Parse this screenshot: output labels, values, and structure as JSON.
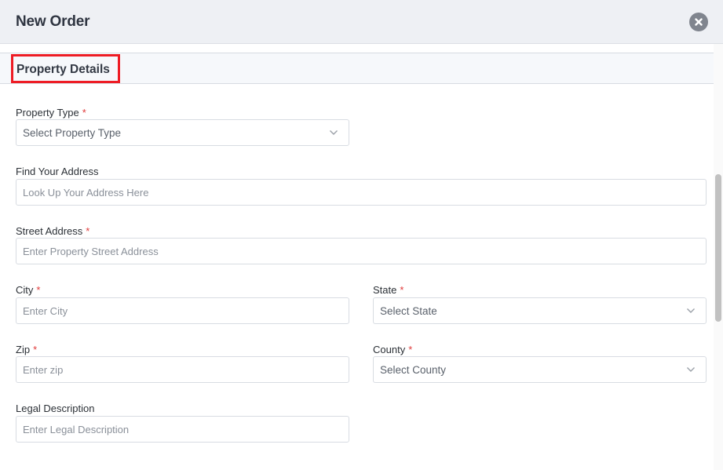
{
  "modal": {
    "title": "New Order"
  },
  "section": {
    "title": "Property Details"
  },
  "form": {
    "property_type": {
      "label": "Property Type",
      "required": "*",
      "value": "Select Property Type"
    },
    "find_address": {
      "label": "Find Your Address",
      "placeholder": "Look Up Your Address Here"
    },
    "street_address": {
      "label": "Street Address",
      "required": "*",
      "placeholder": "Enter Property Street Address"
    },
    "city": {
      "label": "City",
      "required": "*",
      "placeholder": "Enter City"
    },
    "state": {
      "label": "State",
      "required": "*",
      "value": "Select State"
    },
    "zip": {
      "label": "Zip",
      "required": "*",
      "placeholder": "Enter zip"
    },
    "county": {
      "label": "County",
      "required": "*",
      "value": "Select County"
    },
    "legal_description": {
      "label": "Legal Description",
      "placeholder": "Enter Legal Description"
    }
  },
  "icons": {
    "close": "close-circle-icon",
    "dropdown": "chevron-down-icon"
  },
  "colors": {
    "highlight": "#ee1c24",
    "required": "#e03a3a",
    "header_bg": "#eef0f4"
  }
}
